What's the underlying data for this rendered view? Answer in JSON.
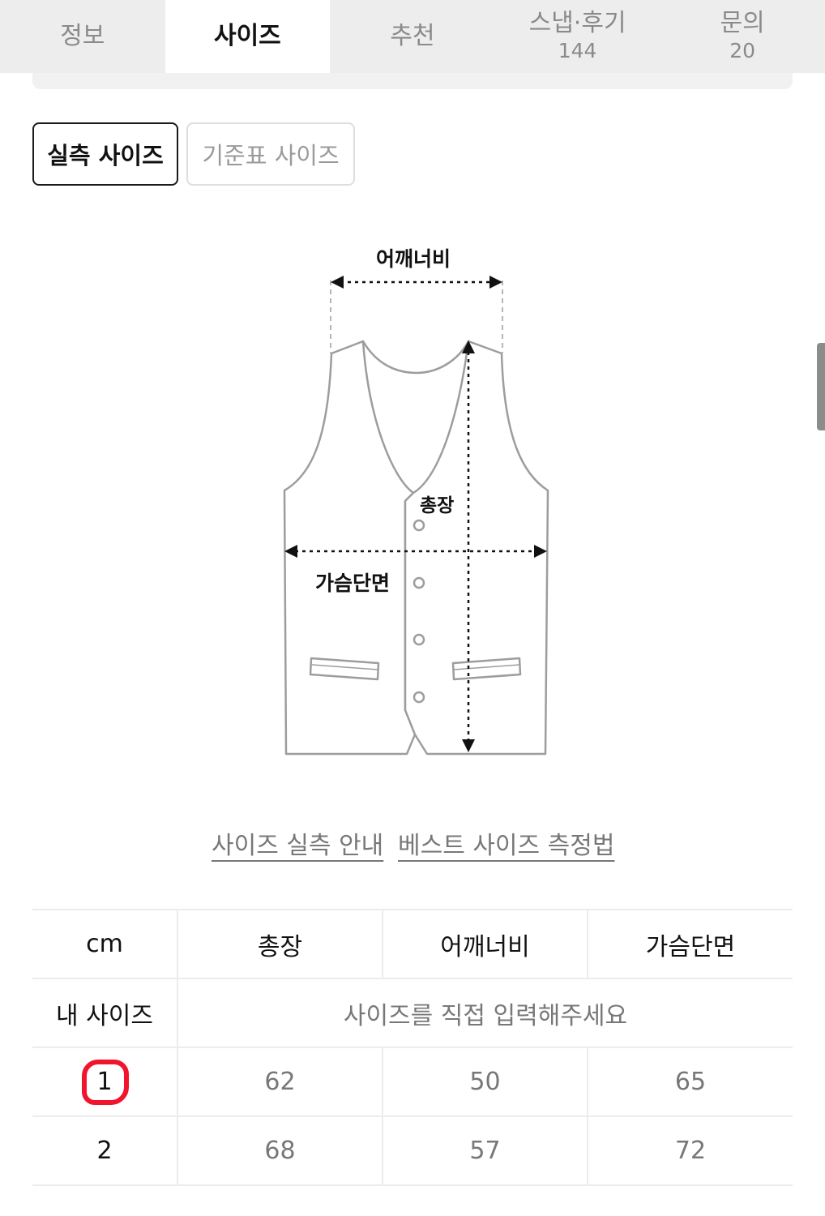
{
  "tabs": [
    {
      "label": "정보",
      "count": ""
    },
    {
      "label": "사이즈",
      "count": ""
    },
    {
      "label": "추천",
      "count": ""
    },
    {
      "label": "스냅·후기",
      "count": "144"
    },
    {
      "label": "문의",
      "count": "20"
    }
  ],
  "active_tab_index": 1,
  "size_toggle": {
    "actual_label": "실측 사이즈",
    "standard_label": "기준표 사이즈",
    "selected": "actual"
  },
  "diagram": {
    "shoulder_label": "어깨너비",
    "length_label": "총장",
    "chest_label": "가슴단면"
  },
  "links": {
    "guide": "사이즈 실측 안내",
    "measure": "베스트 사이즈 측정법"
  },
  "size_table": {
    "unit": "cm",
    "headers": [
      "총장",
      "어깨너비",
      "가슴단면"
    ],
    "my_size": {
      "label": "내 사이즈",
      "prompt": "사이즈를 직접 입력해주세요"
    },
    "rows": [
      {
        "size": "1",
        "values": [
          "62",
          "50",
          "65"
        ],
        "highlighted": true
      },
      {
        "size": "2",
        "values": [
          "68",
          "57",
          "72"
        ],
        "highlighted": false
      }
    ]
  },
  "colors": {
    "highlight_ring": "#f0142d",
    "tab_background": "#ededed"
  }
}
